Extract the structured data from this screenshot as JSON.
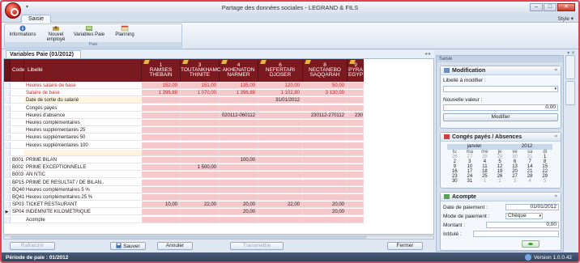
{
  "window": {
    "title": "Partage des données sociales - LEGRAND & FILS"
  },
  "ribbon": {
    "tab": "Saisie",
    "style_menu": "Style ▾",
    "group_label": "Paie",
    "buttons": [
      {
        "label": "Informations",
        "icon": "info-icon"
      },
      {
        "label": "Nouvel employé",
        "icon": "new-employee-icon"
      },
      {
        "label": "Variables Paie",
        "icon": "payroll-variables-icon"
      },
      {
        "label": "Planning",
        "icon": "planning-icon"
      }
    ]
  },
  "doc_tab": "Variables Paie (01/2012)",
  "grid": {
    "headers": {
      "code": "Code",
      "libelle": "Libellé"
    },
    "employees": [
      {
        "num": "1",
        "first": "RAMSES",
        "last": "THEBAIN"
      },
      {
        "num": "3",
        "first": "TOUTANKHAMC",
        "last": "THINITE"
      },
      {
        "num": "4",
        "first": "AKHENATON",
        "last": "NARMER"
      },
      {
        "num": "6",
        "first": "NEFERTARI",
        "last": "DJOSER"
      },
      {
        "num": "8",
        "first": "NECTANEBO",
        "last": "SAQQARAH"
      },
      {
        "num": "9",
        "first": "PYRA",
        "last": "EGYP"
      }
    ],
    "rows": [
      {
        "code": "",
        "label": "Heures salaire de base",
        "style": "red",
        "values": [
          "152,00",
          "151,00",
          "135,00",
          "120,00",
          "50,00",
          ""
        ]
      },
      {
        "code": "",
        "label": "Salaire de base",
        "style": "red",
        "values": [
          "1 396,88",
          "1 070,00",
          "1 396,88",
          "1 102,80",
          "3 130,00",
          ""
        ]
      },
      {
        "code": "",
        "label": "Date de sortie du salarié",
        "style": "hl",
        "values": [
          "",
          "",
          "",
          "31/01/2012",
          "",
          ""
        ]
      },
      {
        "code": "",
        "label": "Congés payés",
        "style": "",
        "values": [
          "",
          "",
          "",
          "",
          "",
          ""
        ]
      },
      {
        "code": "",
        "label": "Heures d'absence",
        "style": "",
        "values": [
          "",
          "",
          "020112-060112",
          "",
          "230112-270112",
          "230"
        ]
      },
      {
        "code": "",
        "label": "Heures complémentaires",
        "style": "",
        "values": [
          "",
          "",
          "",
          "",
          "",
          ""
        ]
      },
      {
        "code": "",
        "label": "Heures supplémentaires 25",
        "style": "",
        "values": [
          "",
          "",
          "",
          "",
          "",
          ""
        ]
      },
      {
        "code": "",
        "label": "Heures supplémentaires 50",
        "style": "",
        "values": [
          "",
          "",
          "",
          "",
          "",
          ""
        ]
      },
      {
        "code": "",
        "label": "Heures supplémentaires 100",
        "style": "",
        "values": [
          "",
          "",
          "",
          "",
          "",
          ""
        ]
      },
      {
        "code": "",
        "label": "",
        "style": "hl",
        "values": [
          "",
          "",
          "",
          "",
          "",
          ""
        ]
      },
      {
        "code": "B001",
        "label": "PRIME BILAN",
        "style": "",
        "values": [
          "",
          "",
          "100,00",
          "",
          "",
          ""
        ]
      },
      {
        "code": "B002",
        "label": "PRIME EXCEPTIONNELLE",
        "style": "",
        "values": [
          "",
          "1 500,00",
          "",
          "",
          "",
          ""
        ]
      },
      {
        "code": "B003",
        "label": "AN NTIC",
        "style": "",
        "values": [
          "",
          "",
          "",
          "",
          "",
          ""
        ]
      },
      {
        "code": "BP15",
        "label": "PRIME DE RESULTAT / DE BILAN..",
        "style": "",
        "values": [
          "",
          "",
          "",
          "",
          "",
          ""
        ]
      },
      {
        "code": "BQ40",
        "label": "Heures complémentaires  5 %",
        "style": "",
        "values": [
          "",
          "",
          "",
          "",
          "",
          ""
        ]
      },
      {
        "code": "BQ41",
        "label": "Heures complémentaires 25 %",
        "style": "",
        "values": [
          "",
          "",
          "",
          "",
          "",
          ""
        ]
      },
      {
        "code": "SP03",
        "label": "TICKET RESTAURANT",
        "style": "",
        "values": [
          "10,00",
          "22,00",
          "20,00",
          "22,00",
          "20,00",
          ""
        ]
      },
      {
        "code": "SP04",
        "label": "INDEMNITE KILOMETRIQUE",
        "style": "",
        "indicator": "▶",
        "values": [
          "",
          "",
          "20,00",
          "",
          "20,00",
          ""
        ]
      },
      {
        "code": "",
        "label": "Acompte",
        "style": "",
        "values": [
          "",
          "",
          "",
          "",
          "",
          ""
        ]
      }
    ]
  },
  "buttons": {
    "refresh": "Rafraîchir",
    "save": "Sauver",
    "cancel": "Annuler",
    "transmit": "Transmettre",
    "close": "Fermer"
  },
  "status": {
    "period": "Période de paie : 01/2012",
    "version": "Version 1.0.0.42"
  },
  "side_panel": {
    "title": "Saisie",
    "modification": {
      "title": "Modification",
      "label_to_modify": "Libellé à modifier :",
      "new_value": "Nouvelle valeur :",
      "value": "0,00",
      "button": "Modifier"
    },
    "conges": {
      "title": "Congés payés / Absences",
      "month": "janvier",
      "year": "2012",
      "day_names": [
        "lu",
        "ma",
        "me",
        "je",
        "ve",
        "sa",
        "di"
      ],
      "days": [
        [
          "26",
          "27",
          "28",
          "29",
          "30",
          "31",
          "1"
        ],
        [
          "2",
          "3",
          "4",
          "5",
          "6",
          "7",
          "8"
        ],
        [
          "9",
          "10",
          "11",
          "12",
          "13",
          "14",
          "15"
        ],
        [
          "16",
          "17",
          "18",
          "19",
          "20",
          "21",
          "22"
        ],
        [
          "23",
          "24",
          "25",
          "26",
          "27",
          "28",
          "29"
        ],
        [
          "30",
          "31",
          "1",
          "2",
          "3",
          "4",
          "5"
        ]
      ]
    },
    "acompte": {
      "title": "Acompte",
      "date_label": "Date de paiement :",
      "date_value": "01/01/2012",
      "mode_label": "Mode de paiement :",
      "mode_value": "Chèque",
      "montant_label": "Montant :",
      "montant_value": "0,00",
      "intitule_label": "Intitulé :"
    }
  }
}
